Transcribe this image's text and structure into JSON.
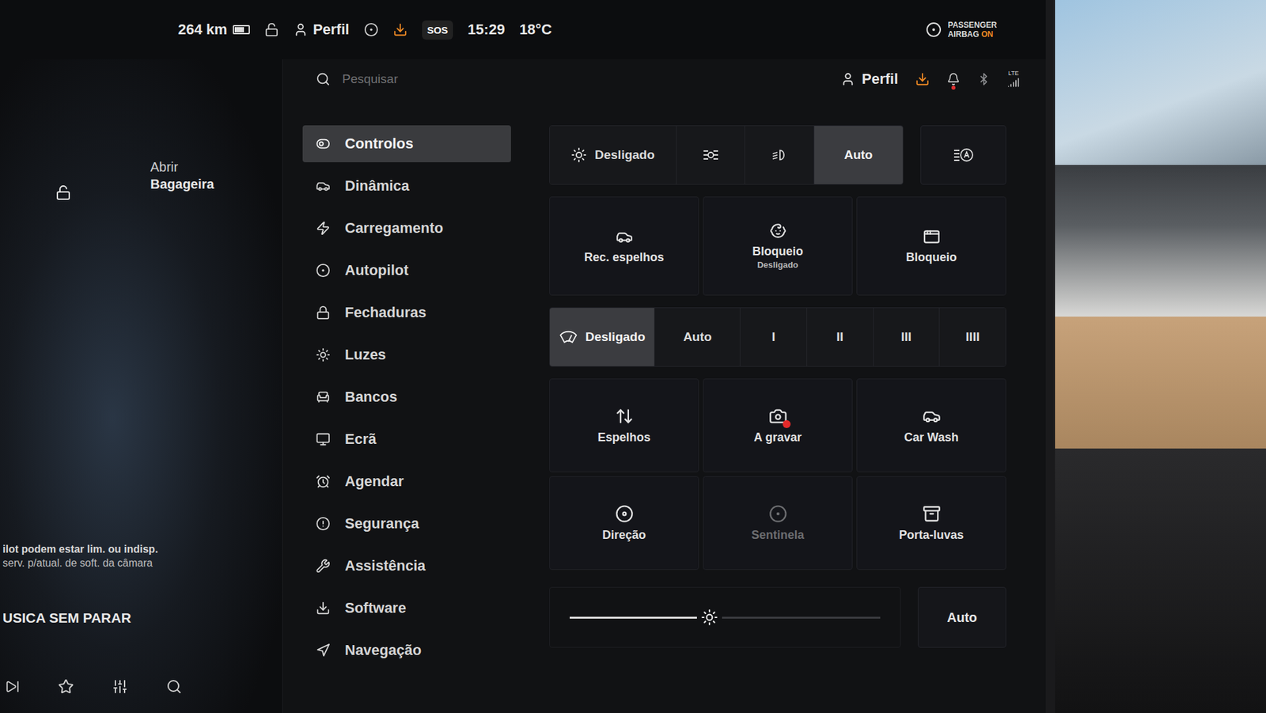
{
  "status_bar": {
    "range": "264 km",
    "battery_level": 0.7,
    "profile": "Perfil",
    "sos": "SOS",
    "time": "15:29",
    "temperature": "18°C",
    "airbag": {
      "line1": "PASSENGER",
      "line2": "AIRBAG",
      "state": "ON"
    }
  },
  "left_panel": {
    "trunk": {
      "line1": "Abrir",
      "line2": "Bagageira"
    },
    "notice": [
      "ilot podem estar lim. ou indisp.",
      "serv. p/atual. de soft. da câmara"
    ],
    "media_title": "USICA SEM PARAR"
  },
  "header": {
    "search_placeholder": "Pesquisar",
    "profile": "Perfil",
    "network": "LTE",
    "notification_unread": true
  },
  "sidebar": {
    "items": [
      {
        "label": "Controlos",
        "kind": "controls",
        "selected": true
      },
      {
        "label": "Dinâmica",
        "kind": "car",
        "selected": false
      },
      {
        "label": "Carregamento",
        "kind": "charge",
        "selected": false
      },
      {
        "label": "Autopilot",
        "kind": "autopilot",
        "selected": false
      },
      {
        "label": "Fechaduras",
        "kind": "lock",
        "selected": false
      },
      {
        "label": "Luzes",
        "kind": "lights",
        "selected": false
      },
      {
        "label": "Bancos",
        "kind": "seat",
        "selected": false
      },
      {
        "label": "Ecrã",
        "kind": "display",
        "selected": false
      },
      {
        "label": "Agendar",
        "kind": "schedule",
        "selected": false
      },
      {
        "label": "Segurança",
        "kind": "safety",
        "selected": false
      },
      {
        "label": "Assistência",
        "kind": "service",
        "selected": false
      },
      {
        "label": "Software",
        "kind": "software",
        "selected": false
      },
      {
        "label": "Navegação",
        "kind": "navigation",
        "selected": false
      }
    ]
  },
  "lights": {
    "options": [
      {
        "label": "Desligado",
        "kind": "off",
        "selected": false
      },
      {
        "label": "",
        "kind": "parking",
        "selected": false
      },
      {
        "label": "",
        "kind": "lowbeam",
        "selected": false
      },
      {
        "label": "Auto",
        "kind": "auto",
        "selected": true
      }
    ],
    "auto_high_beam": false
  },
  "tiles_top": [
    {
      "label": "Rec. espelhos",
      "sub": "",
      "kind": "mirrorfold",
      "disabled": false
    },
    {
      "label": "Bloqueio",
      "sub": "Desligado",
      "kind": "childlock",
      "disabled": false
    },
    {
      "label": "Bloqueio",
      "sub": "",
      "kind": "windowlock",
      "disabled": false
    }
  ],
  "wipers": {
    "options": [
      {
        "label": "Desligado",
        "selected": true
      },
      {
        "label": "Auto",
        "selected": false
      },
      {
        "label": "I",
        "selected": false
      },
      {
        "label": "II",
        "selected": false
      },
      {
        "label": "III",
        "selected": false
      },
      {
        "label": "IIII",
        "selected": false
      }
    ]
  },
  "tiles_bottom": [
    {
      "label": "Espelhos",
      "kind": "mirrors",
      "disabled": false,
      "recording": false
    },
    {
      "label": "A gravar",
      "kind": "dashcam",
      "disabled": false,
      "recording": true
    },
    {
      "label": "Car Wash",
      "kind": "carwash",
      "disabled": false,
      "recording": false
    },
    {
      "label": "Direção",
      "kind": "steering",
      "disabled": false,
      "recording": false
    },
    {
      "label": "Sentinela",
      "kind": "sentry",
      "disabled": true,
      "recording": false
    },
    {
      "label": "Porta-luvas",
      "kind": "glovebox",
      "disabled": false,
      "recording": false
    }
  ],
  "brightness": {
    "level": 0.45,
    "auto_label": "Auto"
  }
}
